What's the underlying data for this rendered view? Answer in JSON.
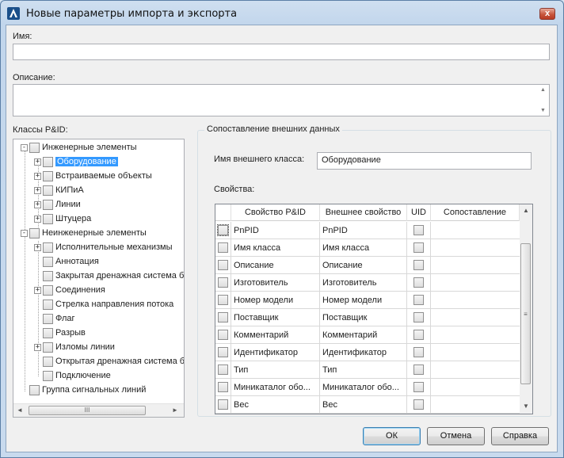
{
  "window": {
    "title": "Новые параметры импорта и экспорта",
    "close_glyph": "x"
  },
  "form": {
    "name_label": "Имя:",
    "name_value": "",
    "description_label": "Описание:",
    "description_value": "",
    "classes_label": "Классы P&ID:"
  },
  "tree": {
    "items": [
      {
        "label": "Инженерные элементы",
        "level": 0,
        "expander": "-"
      },
      {
        "label": "Оборудование",
        "level": 1,
        "expander": "+",
        "selected": true
      },
      {
        "label": "Встраиваемые объекты",
        "level": 1,
        "expander": "+"
      },
      {
        "label": "КИПиА",
        "level": 1,
        "expander": "+"
      },
      {
        "label": "Линии",
        "level": 1,
        "expander": "+"
      },
      {
        "label": "Штуцера",
        "level": 1,
        "expander": "+"
      },
      {
        "label": "Неинженерные элементы",
        "level": 0,
        "expander": "-"
      },
      {
        "label": "Исполнительные механизмы",
        "level": 1,
        "expander": "+"
      },
      {
        "label": "Аннотация",
        "level": 1,
        "expander": ""
      },
      {
        "label": "Закрытая дренажная система б",
        "level": 1,
        "expander": ""
      },
      {
        "label": "Соединения",
        "level": 1,
        "expander": "+"
      },
      {
        "label": "Стрелка направления потока",
        "level": 1,
        "expander": ""
      },
      {
        "label": "Флаг",
        "level": 1,
        "expander": ""
      },
      {
        "label": "Разрыв",
        "level": 1,
        "expander": ""
      },
      {
        "label": "Изломы линии",
        "level": 1,
        "expander": "+"
      },
      {
        "label": "Открытая дренажная система б",
        "level": 1,
        "expander": ""
      },
      {
        "label": "Подключение",
        "level": 1,
        "expander": ""
      },
      {
        "label": "Группа сигнальных линий",
        "level": 0,
        "expander": ""
      }
    ],
    "hscroll_left": "◄",
    "hscroll_right": "►",
    "hscroll_grip": "III"
  },
  "mapping": {
    "group_title": "Сопоставление внешних данных",
    "external_class_label": "Имя внешнего класса:",
    "external_class_value": "Оборудование",
    "properties_label": "Свойства:",
    "columns": [
      "Свойство P&ID",
      "Внешнее свойство",
      "UID",
      "Сопоставление"
    ],
    "rows": [
      {
        "pid": "PnPID",
        "external": "PnPID",
        "focused": true
      },
      {
        "pid": "Имя класса",
        "external": "Имя класса"
      },
      {
        "pid": "Описание",
        "external": "Описание"
      },
      {
        "pid": "Изготовитель",
        "external": "Изготовитель"
      },
      {
        "pid": "Номер модели",
        "external": "Номер модели"
      },
      {
        "pid": "Поставщик",
        "external": "Поставщик"
      },
      {
        "pid": "Комментарий",
        "external": "Комментарий"
      },
      {
        "pid": "Идентификатор",
        "external": "Идентификатор"
      },
      {
        "pid": "Тип",
        "external": "Тип"
      },
      {
        "pid": "Миникаталог обо...",
        "external": "Миникаталог обо..."
      },
      {
        "pid": "Вес",
        "external": "Вес"
      }
    ],
    "vscroll_up": "▲",
    "vscroll_down": "▼",
    "vscroll_grip": "≡"
  },
  "buttons": {
    "ok": "ОК",
    "cancel": "Отмена",
    "help": "Справка"
  },
  "colors": {
    "selection": "#3399ff",
    "default_button_border": "#3c7fb1"
  }
}
